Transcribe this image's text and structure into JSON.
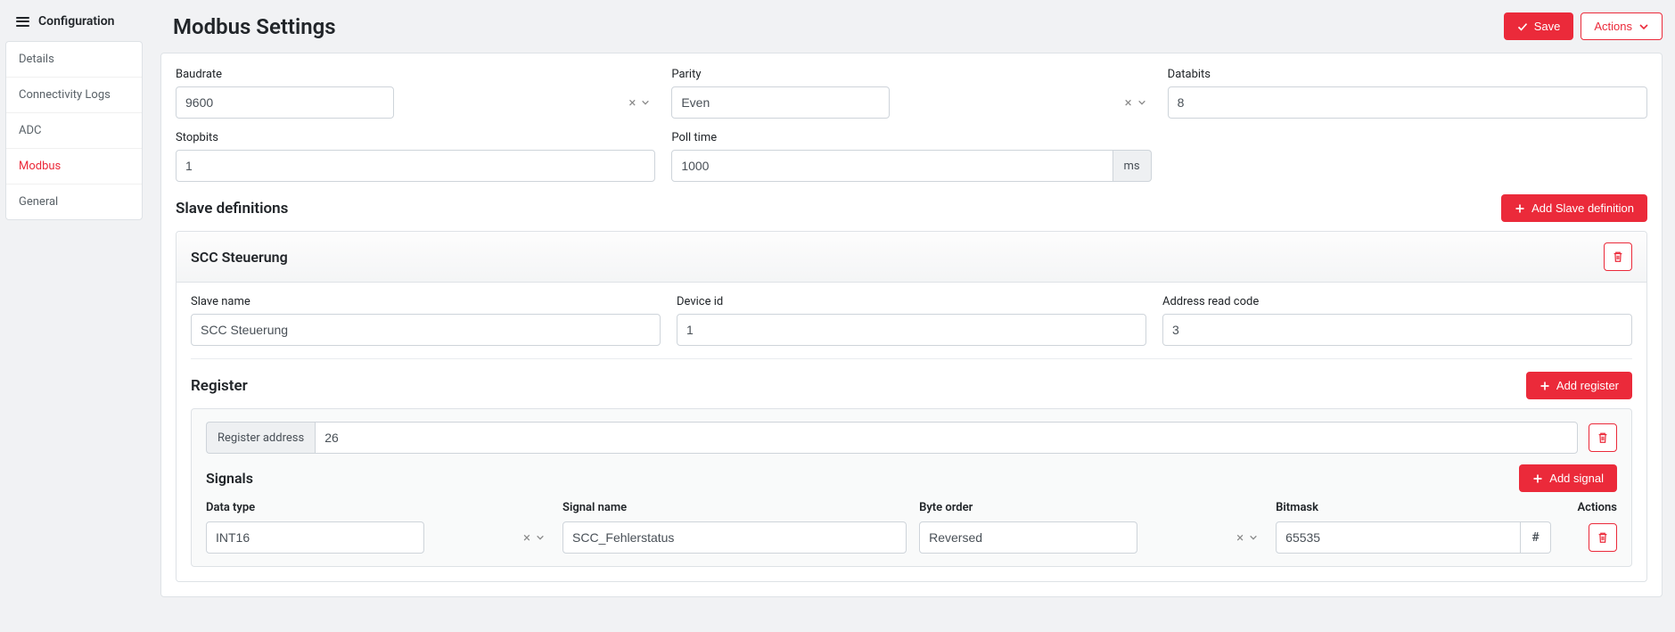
{
  "sidebar": {
    "header": "Configuration",
    "items": [
      {
        "label": "Details"
      },
      {
        "label": "Connectivity Logs"
      },
      {
        "label": "ADC"
      },
      {
        "label": "Modbus",
        "active": true
      },
      {
        "label": "General"
      }
    ]
  },
  "header": {
    "title": "Modbus Settings",
    "save": "Save",
    "actions": "Actions"
  },
  "settings": {
    "baudrate": {
      "label": "Baudrate",
      "value": "9600"
    },
    "parity": {
      "label": "Parity",
      "value": "Even"
    },
    "databits": {
      "label": "Databits",
      "value": "8"
    },
    "stopbits": {
      "label": "Stopbits",
      "value": "1"
    },
    "poll_time": {
      "label": "Poll time",
      "value": "1000",
      "unit": "ms"
    }
  },
  "slave_section": {
    "title": "Slave definitions",
    "add_button": "Add Slave definition"
  },
  "slave": {
    "title": "SCC Steuerung",
    "fields": {
      "name": {
        "label": "Slave name",
        "value": "SCC Steuerung"
      },
      "device_id": {
        "label": "Device id",
        "value": "1"
      },
      "address_read_code": {
        "label": "Address read code",
        "value": "3"
      }
    }
  },
  "register_section": {
    "title": "Register",
    "add_button": "Add register",
    "address_label": "Register address",
    "address_value": "26"
  },
  "signals": {
    "title": "Signals",
    "add_button": "Add signal",
    "columns": {
      "data_type": "Data type",
      "signal_name": "Signal name",
      "byte_order": "Byte order",
      "bitmask": "Bitmask",
      "actions": "Actions"
    },
    "row": {
      "data_type": "INT16",
      "signal_name": "SCC_Fehlerstatus",
      "byte_order": "Reversed",
      "bitmask": "65535",
      "hash": "#"
    }
  }
}
